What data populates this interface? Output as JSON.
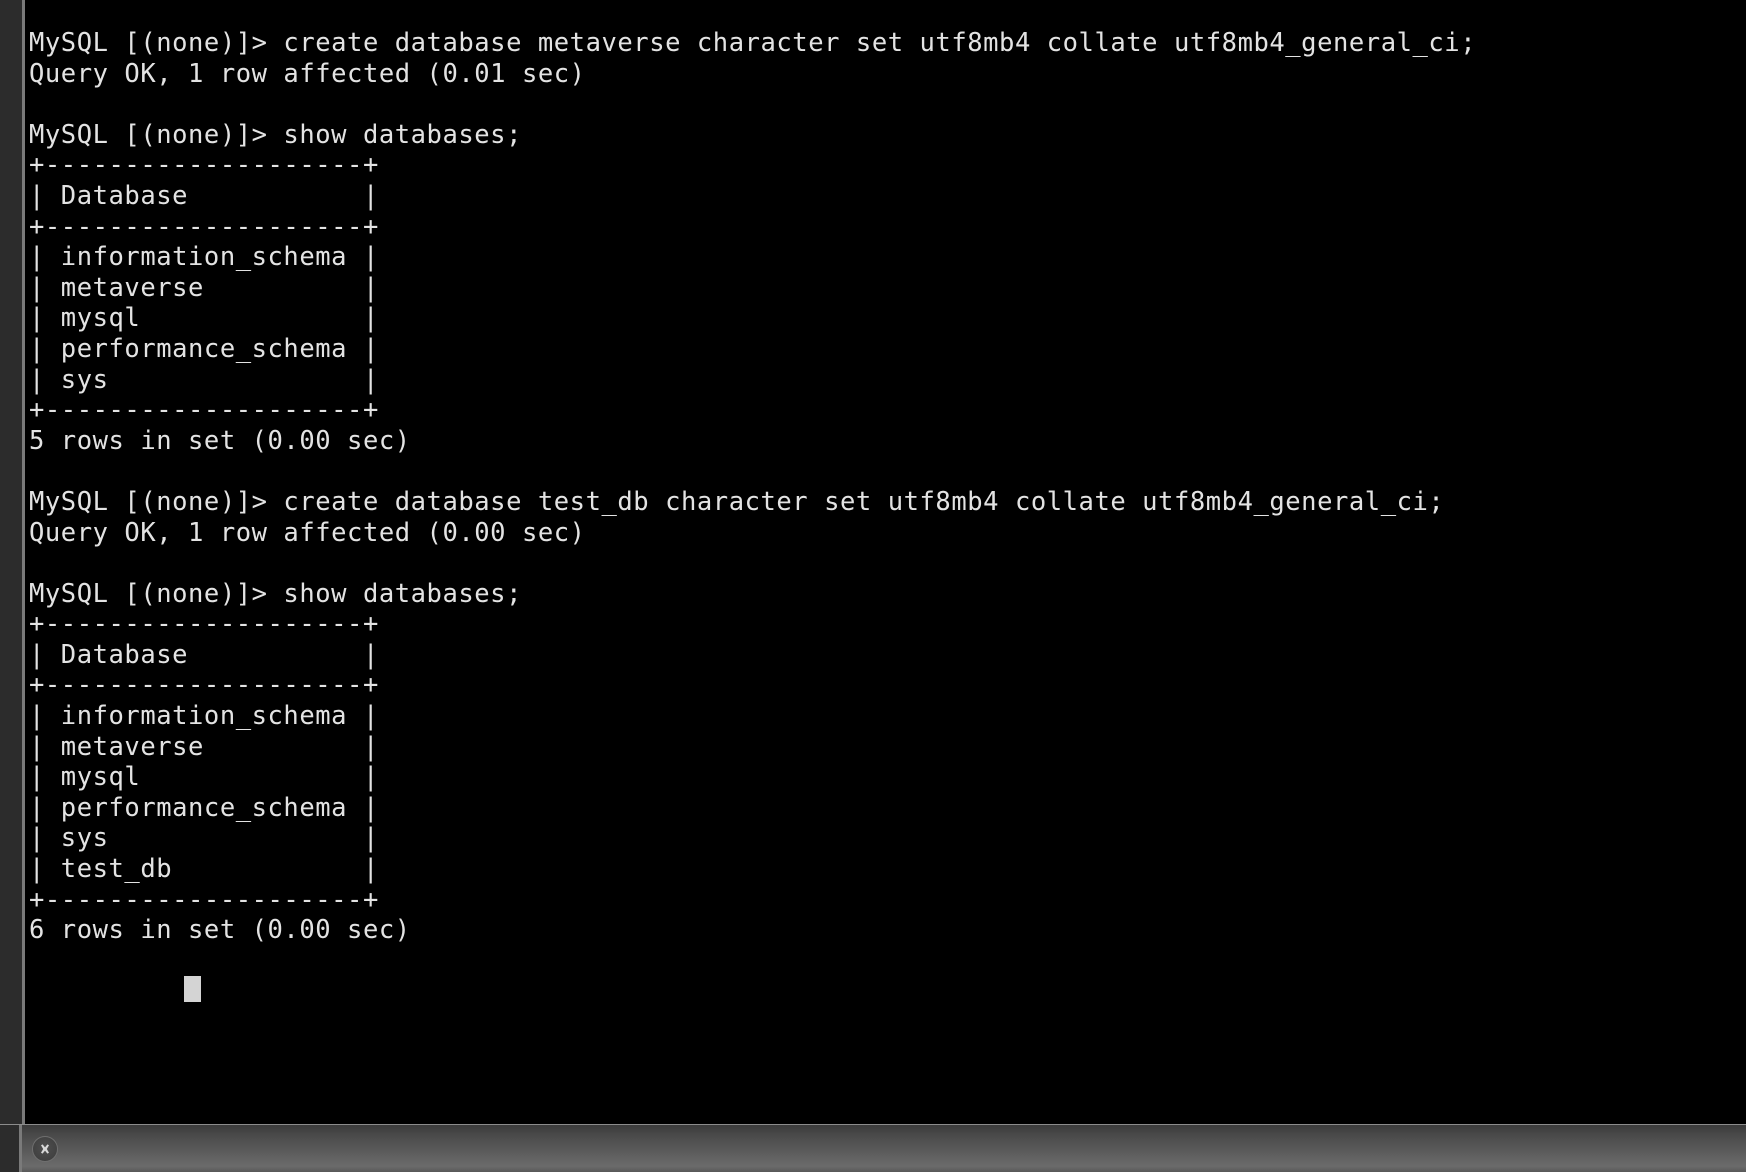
{
  "terminal": {
    "prompt": "MySQL [(none)]> ",
    "colors": {
      "background": "#000000",
      "foreground": "#e3e3e3",
      "gutter": "#2c2c2c",
      "cursor": "#d4d4d4",
      "tabbar_top": "#3b3b3b",
      "tabbar_bottom": "#6b6b6b"
    },
    "lines": [
      "MySQL [(none)]> create database metaverse character set utf8mb4 collate utf8mb4_general_ci;",
      "Query OK, 1 row affected (0.01 sec)",
      "",
      "MySQL [(none)]> show databases;",
      "+--------------------+",
      "| Database           |",
      "+--------------------+",
      "| information_schema |",
      "| metaverse          |",
      "| mysql              |",
      "| performance_schema |",
      "| sys                |",
      "+--------------------+",
      "5 rows in set (0.00 sec)",
      "",
      "MySQL [(none)]> create database test_db character set utf8mb4 collate utf8mb4_general_ci;",
      "Query OK, 1 row affected (0.00 sec)",
      "",
      "MySQL [(none)]> show databases;",
      "+--------------------+",
      "| Database           |",
      "+--------------------+",
      "| information_schema |",
      "| metaverse          |",
      "| mysql              |",
      "| performance_schema |",
      "| sys                |",
      "| test_db            |",
      "+--------------------+",
      "6 rows in set (0.00 sec)",
      ""
    ],
    "current_prompt": "MySQL [(none)]> ",
    "cursor": "block"
  },
  "commands": [
    {
      "prompt": "MySQL [(none)]>",
      "input": "create database metaverse character set utf8mb4 collate utf8mb4_general_ci;",
      "result": "Query OK, 1 row affected (0.01 sec)"
    },
    {
      "prompt": "MySQL [(none)]>",
      "input": "show databases;",
      "result": "5 rows in set (0.00 sec)"
    },
    {
      "prompt": "MySQL [(none)]>",
      "input": "create database test_db character set utf8mb4 collate utf8mb4_general_ci;",
      "result": "Query OK, 1 row affected (0.00 sec)"
    },
    {
      "prompt": "MySQL [(none)]>",
      "input": "show databases;",
      "result": "6 rows in set (0.00 sec)"
    }
  ],
  "tables": [
    {
      "header": "Database",
      "rows": [
        "information_schema",
        "metaverse",
        "mysql",
        "performance_schema",
        "sys"
      ],
      "row_count_text": "5 rows in set (0.00 sec)"
    },
    {
      "header": "Database",
      "rows": [
        "information_schema",
        "metaverse",
        "mysql",
        "performance_schema",
        "sys",
        "test_db"
      ],
      "row_count_text": "6 rows in set (0.00 sec)"
    }
  ],
  "tab_bar": {
    "close_icon": "close-x-icon"
  }
}
